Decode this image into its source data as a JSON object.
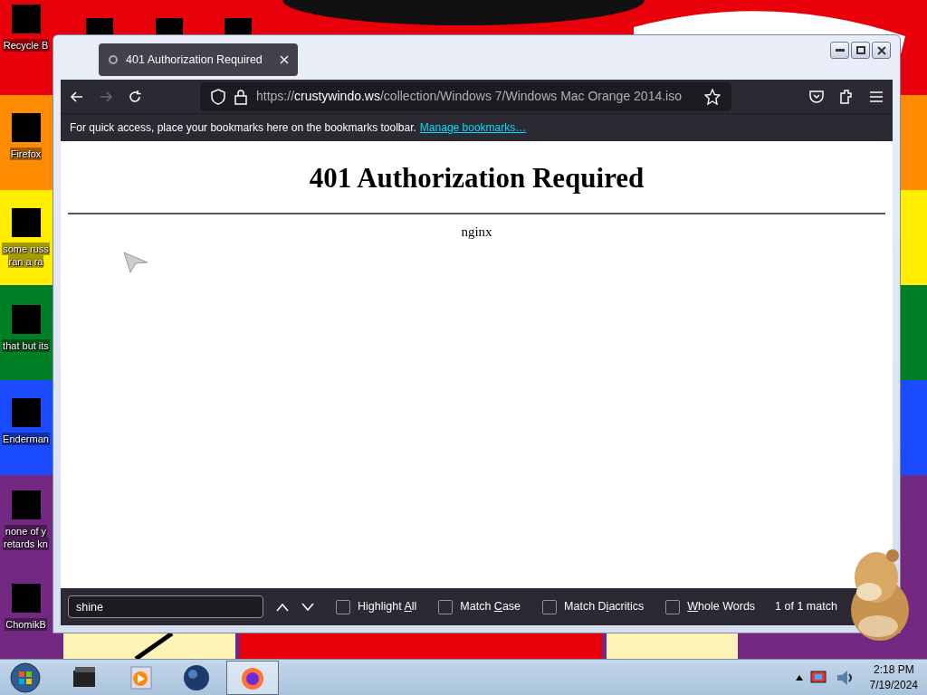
{
  "desktop": {
    "icons": [
      {
        "lines": [
          "Recycle B"
        ]
      },
      {
        "lines": [
          "Firefox"
        ]
      },
      {
        "lines": [
          "some russ",
          "ran a ra"
        ]
      },
      {
        "lines": [
          "that but its"
        ]
      },
      {
        "lines": [
          "Enderman"
        ]
      },
      {
        "lines": [
          "none of y",
          "retards kn"
        ]
      },
      {
        "lines": [
          "ChomikB"
        ]
      }
    ]
  },
  "browser": {
    "tabs": [
      {
        "title": "401 Authorization Required",
        "selected": true
      }
    ],
    "nav": {
      "back_disabled": false,
      "forward_disabled": true
    },
    "url": {
      "scheme": "https://",
      "domain": "crustywindo.ws",
      "path": "/collection/Windows 7/Windows Mac Orange 2014.iso"
    },
    "bookmarks_bar": {
      "text": "For quick access, place your bookmarks here on the bookmarks toolbar.",
      "link": "Manage bookmarks…"
    },
    "page": {
      "heading": "401 Authorization Required",
      "footer": "nginx"
    },
    "find_bar": {
      "query": "shine",
      "options": [
        {
          "before": "Highlight ",
          "key": "A",
          "after": "ll",
          "checked": false
        },
        {
          "before": "Match ",
          "key": "C",
          "after": "ase",
          "checked": false
        },
        {
          "before": "Match D",
          "key": "i",
          "after": "acritics",
          "checked": false
        },
        {
          "key": "W",
          "after": "hole Words",
          "checked": false
        }
      ],
      "status": "1 of 1 match"
    }
  },
  "taskbar": {
    "items": [
      {
        "selected": false
      },
      {
        "selected": false
      },
      {
        "selected": false
      },
      {
        "selected": true
      }
    ],
    "clock": {
      "time": "2:18 PM",
      "date": "7/19/2024"
    }
  }
}
